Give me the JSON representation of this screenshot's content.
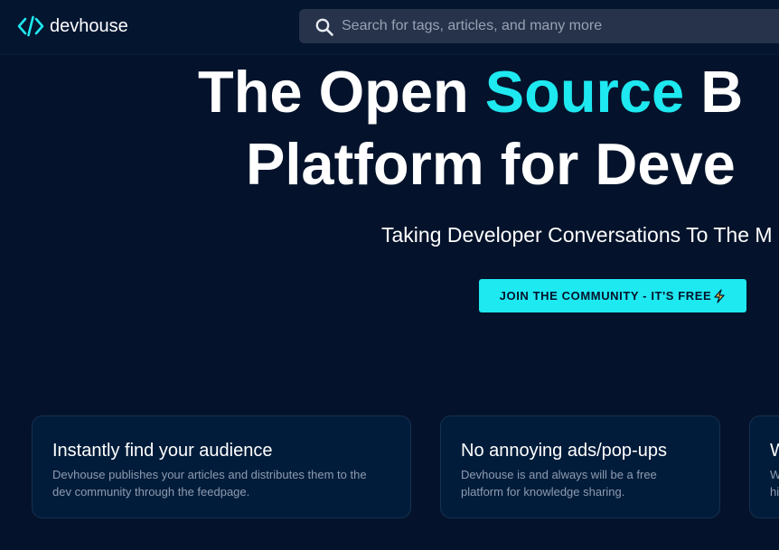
{
  "header": {
    "logo_text": "devhouse",
    "logo_icon": "code-brackets-icon",
    "search_placeholder": "Search for tags, articles, and many more",
    "search_icon": "search-icon"
  },
  "hero": {
    "line1_part1": "The Open ",
    "line1_accent": "Source",
    "line1_part2": " B",
    "line2": "Platform for Deve",
    "subtitle": "Taking Developer Conversations To The M",
    "cta_label": "JOIN THE COMMUNITY - IT'S FREE",
    "cta_icon": "lightning-bolt-icon"
  },
  "features": [
    {
      "title": "Instantly find your audience",
      "line1": "Devhouse publishes your articles and distributes them to the",
      "line2": "dev community through the feedpage."
    },
    {
      "title": "No annoying ads/pop-ups",
      "line1": "Devhouse is and always will be a free",
      "line2": "platform for knowledge sharing."
    },
    {
      "title": "W",
      "line1": "W",
      "line2": "hi"
    }
  ],
  "colors": {
    "background": "#04132b",
    "accent": "#1ee8f0",
    "card": "#011c3a",
    "search_bg": "#27334b"
  }
}
